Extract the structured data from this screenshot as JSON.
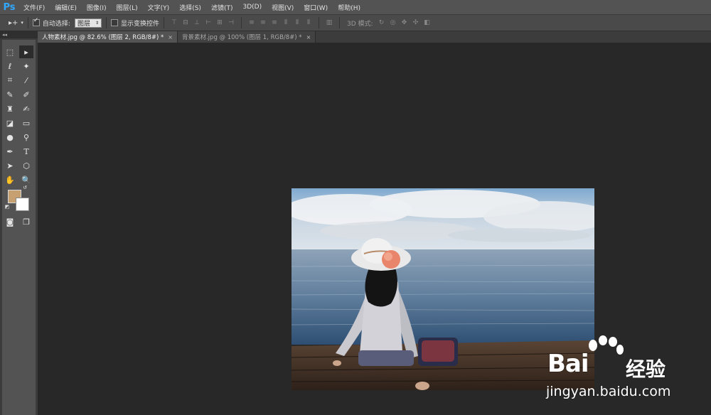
{
  "app": {
    "logo": "Ps"
  },
  "menu": [
    "文件(F)",
    "编辑(E)",
    "图像(I)",
    "图层(L)",
    "文字(Y)",
    "选择(S)",
    "滤镜(T)",
    "3D(D)",
    "视图(V)",
    "窗口(W)",
    "帮助(H)"
  ],
  "options": {
    "tool_glyph": "▸+",
    "auto_select_label": "自动选择:",
    "auto_select_checked": true,
    "layer_select_value": "图层",
    "show_transform_label": "显示变换控件",
    "show_transform_checked": false,
    "mode3d_label": "3D 模式:"
  },
  "tabs": [
    {
      "label": "人物素材.jpg @ 82.6% (图层 2, RGB/8#) *",
      "close": "×",
      "active": true
    },
    {
      "label": "背景素材.jpg @ 100% (图层 1, RGB/8#) *",
      "close": "×",
      "active": false
    }
  ],
  "toolbox": {
    "collapse_glyph": "◂◂"
  },
  "colors": {
    "foreground": "#c7a071",
    "background": "#ffffff",
    "accent": "#31a8ff"
  },
  "watermark": {
    "brand_left": "Bai",
    "brand_right": "经验",
    "url": "jingyan.baidu.com"
  }
}
